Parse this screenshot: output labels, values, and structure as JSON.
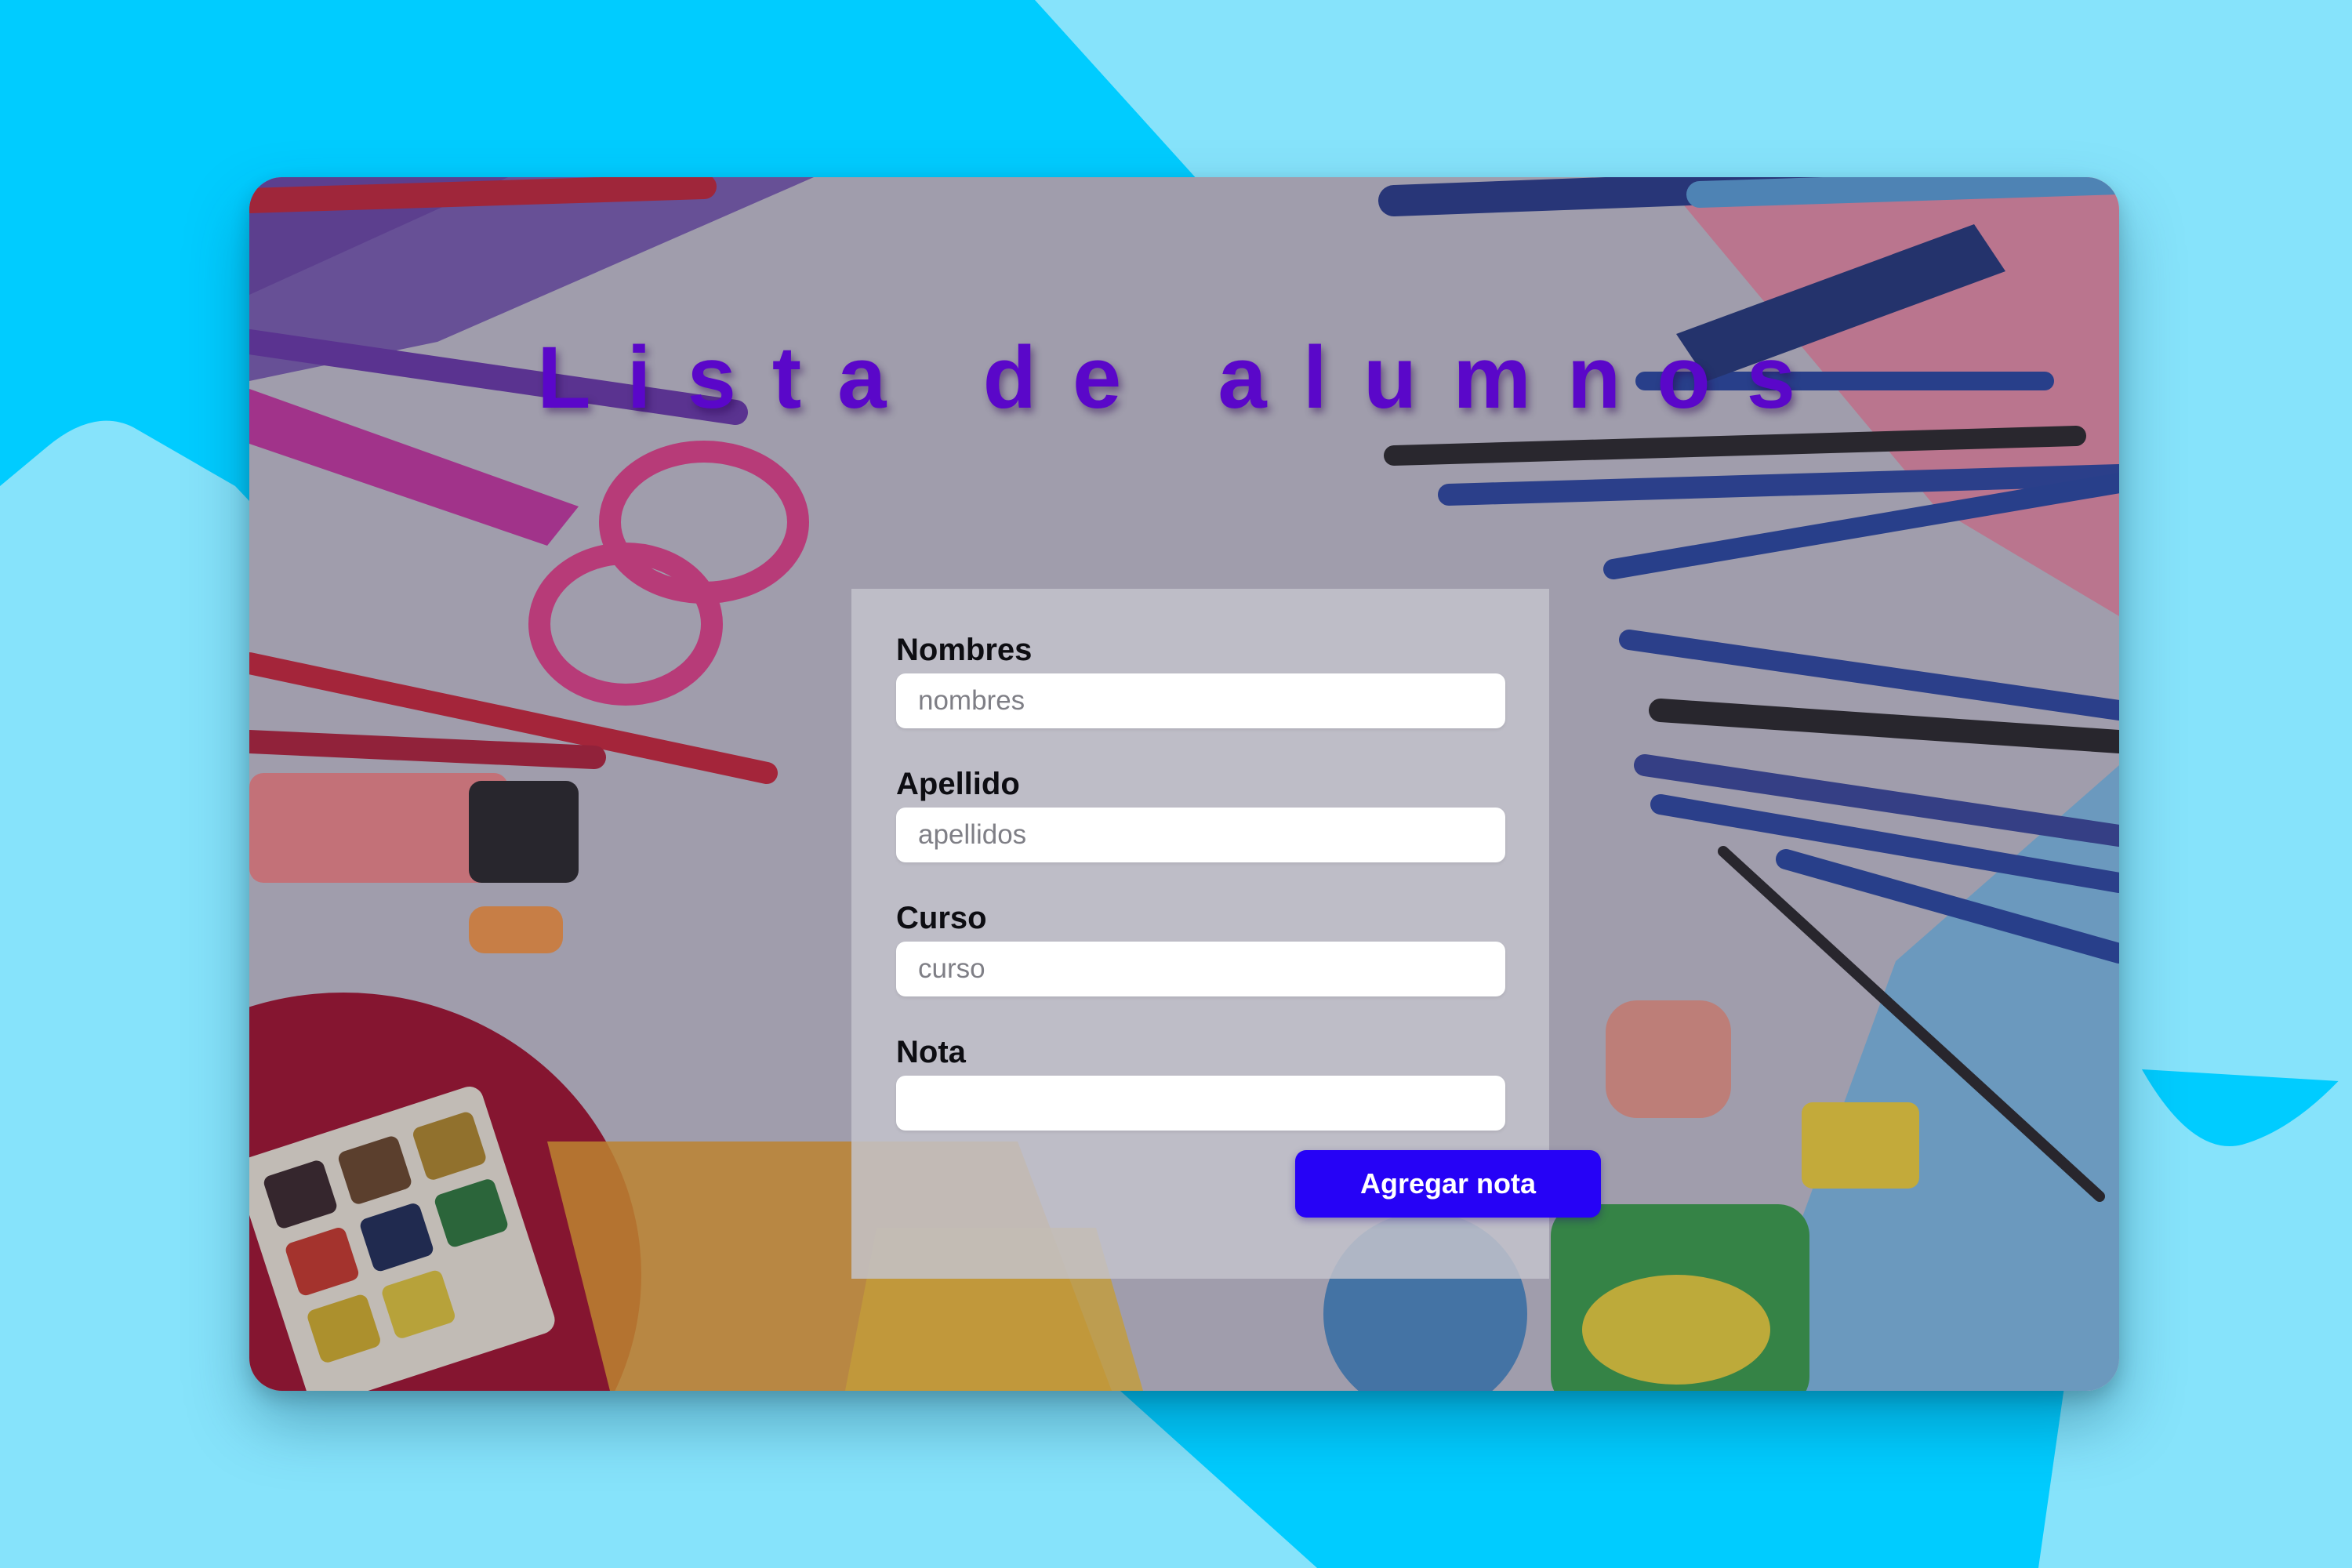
{
  "page": {
    "title": "Lista de alumnos"
  },
  "form": {
    "fields": [
      {
        "label": "Nombres",
        "placeholder": "nombres",
        "value": ""
      },
      {
        "label": "Apellido",
        "placeholder": "apellidos",
        "value": ""
      },
      {
        "label": "Curso",
        "placeholder": "curso",
        "value": ""
      },
      {
        "label": "Nota",
        "placeholder": "",
        "value": ""
      }
    ],
    "submit_label": "Agregar nota"
  },
  "colors": {
    "title": "#5a07c9",
    "button": "#2602f6",
    "outer_background": "#86e3fb",
    "outer_accent": "#00ccff"
  }
}
